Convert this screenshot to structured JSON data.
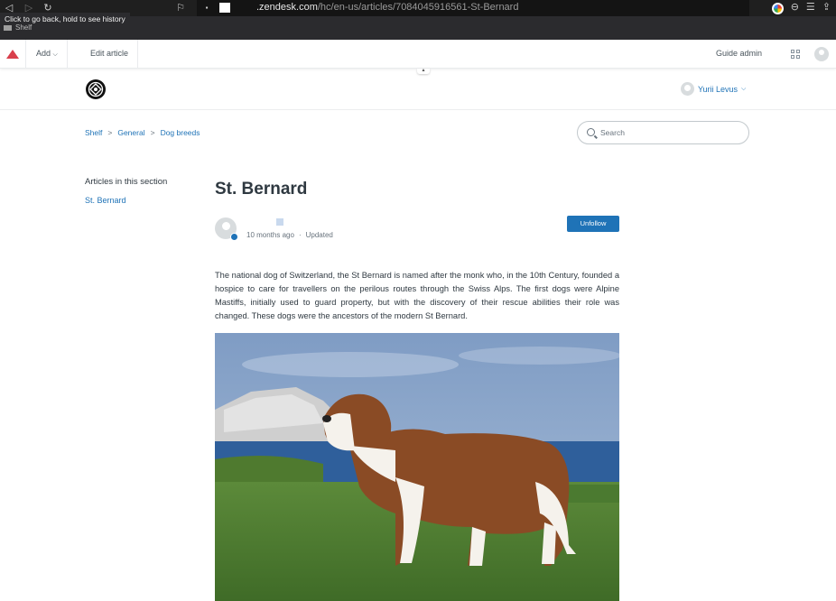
{
  "browser": {
    "url_host": ".zendesk.com",
    "url_path": "/hc/en-us/articles/7084045916561-St-Bernard",
    "tooltip": "Click to go back, hold to see history",
    "tab_label": "Shelf"
  },
  "admin_bar": {
    "add_label": "Add",
    "edit_label": "Edit article",
    "guide_admin_label": "Guide admin"
  },
  "header": {
    "user_name": "Yurii Levus"
  },
  "breadcrumbs": [
    "Shelf",
    "General",
    "Dog breeds"
  ],
  "search": {
    "placeholder": "Search"
  },
  "sidebar": {
    "title": "Articles in this section",
    "items": [
      "St. Bernard"
    ]
  },
  "article": {
    "title": "St. Bernard",
    "time_ago": "10 months ago",
    "updated_label": "Updated",
    "follow_label": "Unfollow",
    "body": "The national dog of Switzerland, the St Bernard is named after the monk who, in the 10th Century, founded a hospice to care for travellers on the perilous routes through the Swiss Alps. The first dogs were Alpine Mastiffs, initially used to guard property, but with the discovery of their rescue abilities their role was changed. These dogs were the ancestors of the modern St Bernard."
  },
  "colors": {
    "link": "#1f73b7",
    "button": "#1f73b7",
    "zendesk_red": "#d93f4c"
  }
}
